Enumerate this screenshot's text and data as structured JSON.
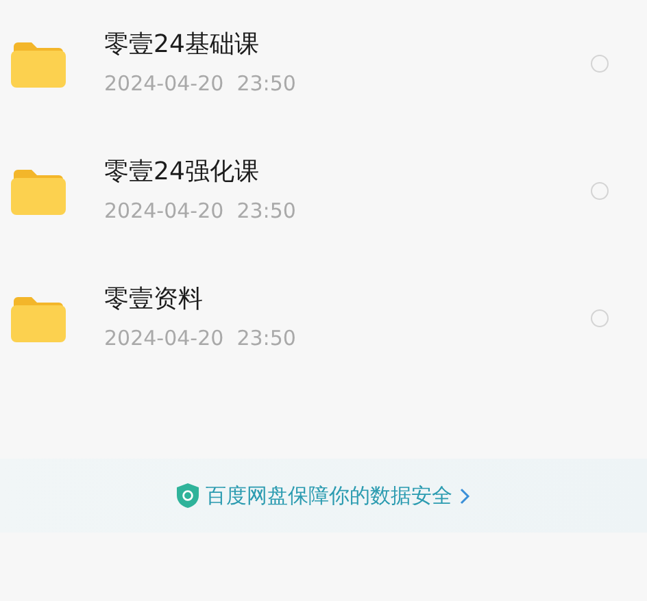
{
  "files": [
    {
      "name": "零壹24基础课",
      "modified": "2024-04-20  23:50",
      "selected": false
    },
    {
      "name": "零壹24强化课",
      "modified": "2024-04-20  23:50",
      "selected": false
    },
    {
      "name": "零壹资料",
      "modified": "2024-04-20  23:50",
      "selected": false
    }
  ],
  "footer": {
    "text": "百度网盘保障你的数据安全"
  }
}
